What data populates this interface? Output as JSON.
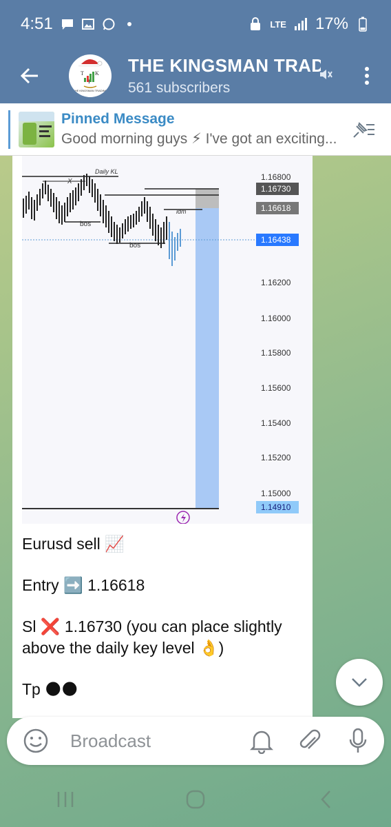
{
  "status_bar": {
    "time": "4:51",
    "network": "LTE",
    "battery": "17%",
    "icons": [
      "message-icon",
      "gallery-icon",
      "whatsapp-icon",
      "dot-icon",
      "lock-icon",
      "signal-icon",
      "battery-icon"
    ]
  },
  "header": {
    "title": "THE KINGSMAN TRADING",
    "subscribers": "561 subscribers",
    "avatar_caption": "THE KINGSMAN TRADING",
    "avatar_monogram": "TKT"
  },
  "pinned": {
    "title": "Pinned Message",
    "body": "Good morning guys ⚡  I've got an exciting..."
  },
  "chart": {
    "price_labels": [
      "1.16800",
      "1.16200",
      "1.16000",
      "1.15800",
      "1.15600",
      "1.15400",
      "1.15200",
      "1.15000"
    ],
    "tag_labels": [
      "1.16730",
      "1.16618",
      "1.16438",
      "1.14910"
    ],
    "annotations": {
      "daily_kl": "Daily KL",
      "x_mark": "X",
      "bos_1": "bos",
      "bos_2": "bos",
      "idm": "idm"
    }
  },
  "message": {
    "line1": "Eurusd sell 📈",
    "line2": "Entry ➡️ 1.16618",
    "line3": "Sl ❌ 1.16730 (you can place slightly above the daily key level 👌)",
    "line4": "Tp 🌑🌑"
  },
  "composer": {
    "placeholder": "Broadcast"
  },
  "colors": {
    "header": "#5a7da6",
    "accent": "#3b8bc5",
    "tp_zone": "#a9c9f5",
    "sl_zone": "#bdbdbd"
  }
}
